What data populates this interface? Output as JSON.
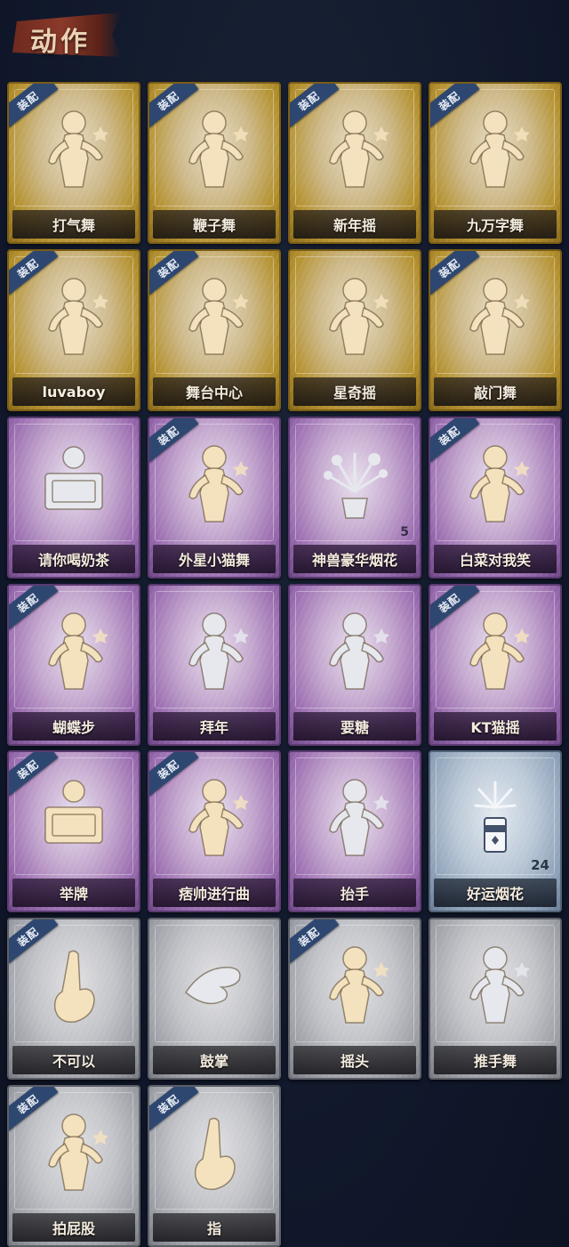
{
  "header": {
    "title": "动作"
  },
  "equip_label": "装配",
  "cards": [
    {
      "label": "打气舞",
      "tier": "gold",
      "equipped": true,
      "icon": "figure-dance-icon",
      "count": ""
    },
    {
      "label": "鞭子舞",
      "tier": "gold",
      "equipped": true,
      "icon": "figure-dance-icon",
      "count": ""
    },
    {
      "label": "新年摇",
      "tier": "gold",
      "equipped": true,
      "icon": "figure-dance-icon",
      "count": ""
    },
    {
      "label": "九万字舞",
      "tier": "gold",
      "equipped": true,
      "icon": "figure-dance-icon",
      "count": ""
    },
    {
      "label": "luvaboy",
      "tier": "gold",
      "equipped": true,
      "icon": "figure-dance-icon",
      "count": ""
    },
    {
      "label": "舞台中心",
      "tier": "gold",
      "equipped": true,
      "icon": "figure-dance-icon",
      "count": ""
    },
    {
      "label": "星奇摇",
      "tier": "gold",
      "equipped": false,
      "icon": "figure-wave-icon",
      "count": ""
    },
    {
      "label": "敲门舞",
      "tier": "gold",
      "equipped": true,
      "icon": "figure-dance-icon",
      "count": ""
    },
    {
      "label": "请你喝奶茶",
      "tier": "purple",
      "equipped": false,
      "icon": "figure-sign-icon",
      "count": ""
    },
    {
      "label": "外星小猫舞",
      "tier": "purple",
      "equipped": true,
      "icon": "figure-dance-icon",
      "count": ""
    },
    {
      "label": "神兽豪华烟花",
      "tier": "purple",
      "equipped": false,
      "icon": "fireworks-icon",
      "count": "5"
    },
    {
      "label": "白菜对我笑",
      "tier": "purple",
      "equipped": true,
      "icon": "figure-dance-icon",
      "count": ""
    },
    {
      "label": "蝴蝶步",
      "tier": "purple",
      "equipped": true,
      "icon": "figure-arms-icon",
      "count": ""
    },
    {
      "label": "拜年",
      "tier": "purple",
      "equipped": false,
      "icon": "figure-bow-icon",
      "count": ""
    },
    {
      "label": "要糖",
      "tier": "purple",
      "equipped": false,
      "icon": "figure-reach-icon",
      "count": ""
    },
    {
      "label": "KT猫摇",
      "tier": "purple",
      "equipped": true,
      "icon": "figure-dance-icon",
      "count": ""
    },
    {
      "label": "举牌",
      "tier": "purple",
      "equipped": true,
      "icon": "figure-sign-icon",
      "count": ""
    },
    {
      "label": "痞帅进行曲",
      "tier": "purple",
      "equipped": true,
      "icon": "figure-dance-icon",
      "count": ""
    },
    {
      "label": "抬手",
      "tier": "purple",
      "equipped": false,
      "icon": "figure-reach-icon",
      "count": ""
    },
    {
      "label": "好运烟花",
      "tier": "blue",
      "equipped": false,
      "icon": "firecracker-icon",
      "count": "24"
    },
    {
      "label": "不可以",
      "tier": "gray",
      "equipped": true,
      "icon": "finger-wag-icon",
      "count": ""
    },
    {
      "label": "鼓掌",
      "tier": "gray",
      "equipped": false,
      "icon": "clap-hands-icon",
      "count": ""
    },
    {
      "label": "摇头",
      "tier": "gray",
      "equipped": true,
      "icon": "figure-shake-icon",
      "count": ""
    },
    {
      "label": "推手舞",
      "tier": "gray",
      "equipped": false,
      "icon": "figure-push-icon",
      "count": ""
    },
    {
      "label": "拍屁股",
      "tier": "gray",
      "equipped": true,
      "icon": "figure-bend-icon",
      "count": ""
    },
    {
      "label": "指",
      "tier": "gray",
      "equipped": true,
      "icon": "point-hand-icon",
      "count": ""
    }
  ],
  "colors": {
    "gold_icon": "#f4e2bf",
    "gray_icon": "#e6e8ee",
    "equip_tag": "#2e4770"
  }
}
